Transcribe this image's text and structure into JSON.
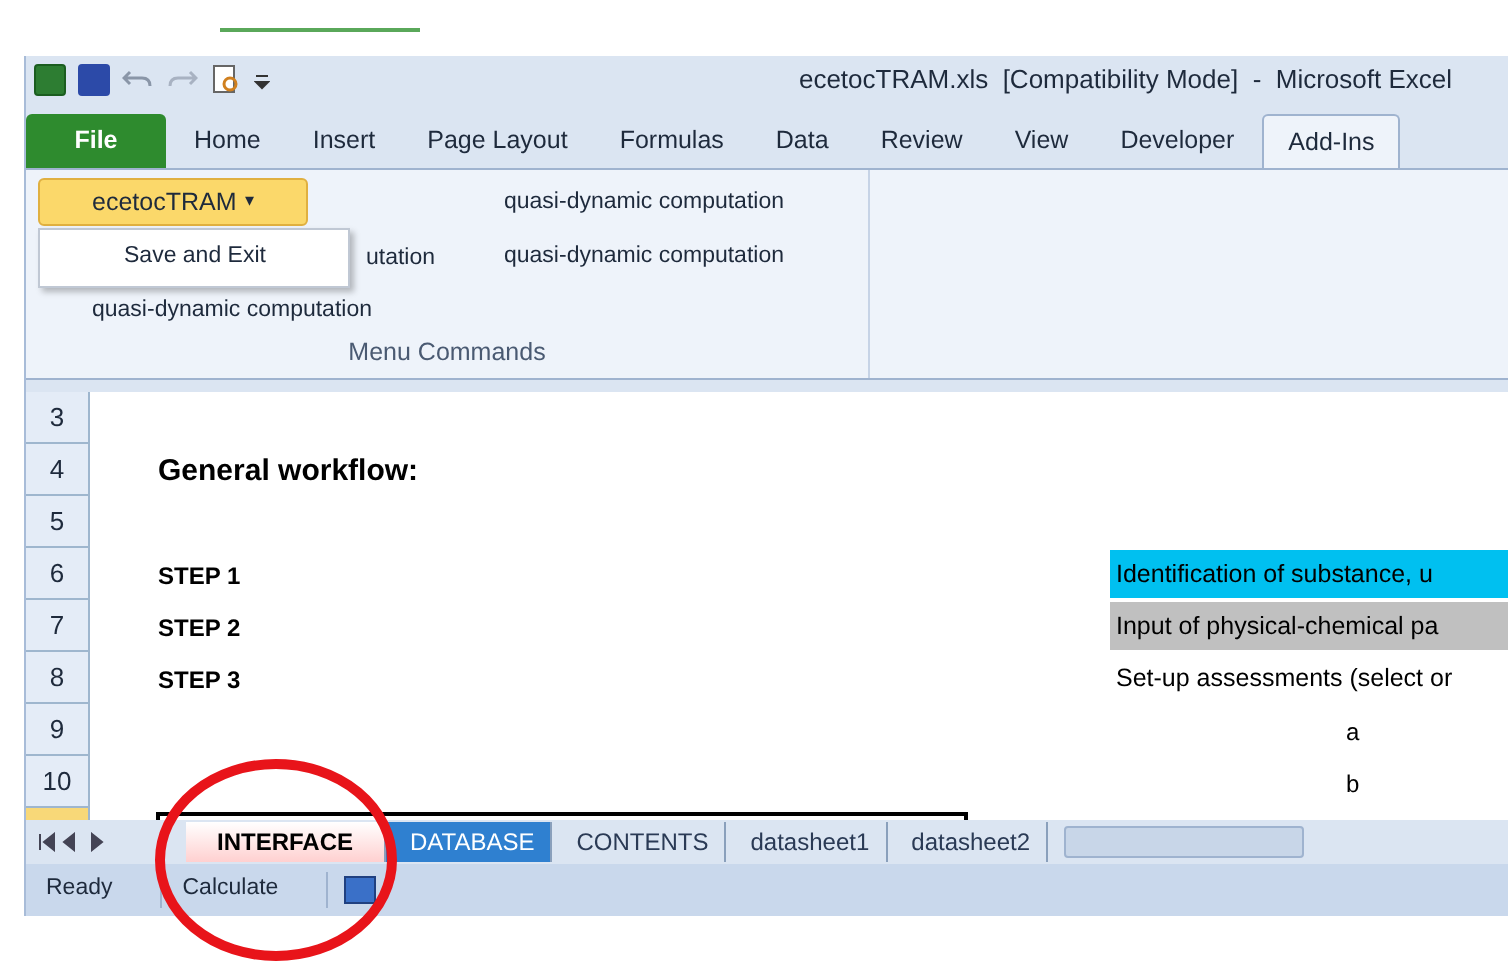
{
  "window": {
    "title": "ecetocTRAM.xls  [Compatibility Mode]  -  Microsoft Excel"
  },
  "ribbon_tabs": [
    {
      "label": "File",
      "kind": "file",
      "selected": false
    },
    {
      "label": "Home",
      "kind": "tab",
      "selected": false
    },
    {
      "label": "Insert",
      "kind": "tab",
      "selected": false
    },
    {
      "label": "Page Layout",
      "kind": "tab",
      "selected": false
    },
    {
      "label": "Formulas",
      "kind": "tab",
      "selected": false
    },
    {
      "label": "Data",
      "kind": "tab",
      "selected": false
    },
    {
      "label": "Review",
      "kind": "tab",
      "selected": false
    },
    {
      "label": "View",
      "kind": "tab",
      "selected": false
    },
    {
      "label": "Developer",
      "kind": "tab",
      "selected": false
    },
    {
      "label": "Add-Ins",
      "kind": "tab",
      "selected": true
    }
  ],
  "ribbon": {
    "menu_button": "ecetocTRAM",
    "menu_caret": "▾",
    "dropdown_item": "Save and Exit",
    "left_commands": [
      "utation",
      "quasi-dynamic computation"
    ],
    "right_commands": [
      "quasi-dynamic computation",
      "quasi-dynamic computation"
    ],
    "group_label": "Menu Commands"
  },
  "rows": [
    {
      "number": "3",
      "cells": []
    },
    {
      "number": "4",
      "cells": [
        {
          "text": "General workflow:",
          "kind": "heading"
        }
      ]
    },
    {
      "number": "5",
      "cells": []
    },
    {
      "number": "6",
      "cells": [
        {
          "text": "STEP 1",
          "kind": "step"
        },
        {
          "text": "Identification of substance, u",
          "kind": "note",
          "color": "#00c0f0"
        }
      ]
    },
    {
      "number": "7",
      "cells": [
        {
          "text": "STEP 2",
          "kind": "step"
        },
        {
          "text": "Input of physical-chemical pa",
          "kind": "note",
          "color": "#c0c0c0"
        }
      ]
    },
    {
      "number": "8",
      "cells": [
        {
          "text": "STEP 3",
          "kind": "step"
        },
        {
          "text": "Set-up assessments (select or",
          "kind": "note"
        }
      ]
    },
    {
      "number": "9",
      "cells": [
        {
          "text": "a",
          "kind": "sub"
        }
      ]
    },
    {
      "number": "10",
      "cells": [
        {
          "text": "b",
          "kind": "sub"
        }
      ]
    }
  ],
  "sheet_tabs": [
    {
      "label": "INTERFACE",
      "selected": true
    },
    {
      "label": "DATABASE",
      "selected": false,
      "color": "#2f80d0"
    },
    {
      "label": "CONTENTS",
      "selected": false
    },
    {
      "label": "datasheet1",
      "selected": false
    },
    {
      "label": "datasheet2",
      "selected": false
    }
  ],
  "status_bar": {
    "items": [
      "Ready",
      "Calculate"
    ]
  }
}
